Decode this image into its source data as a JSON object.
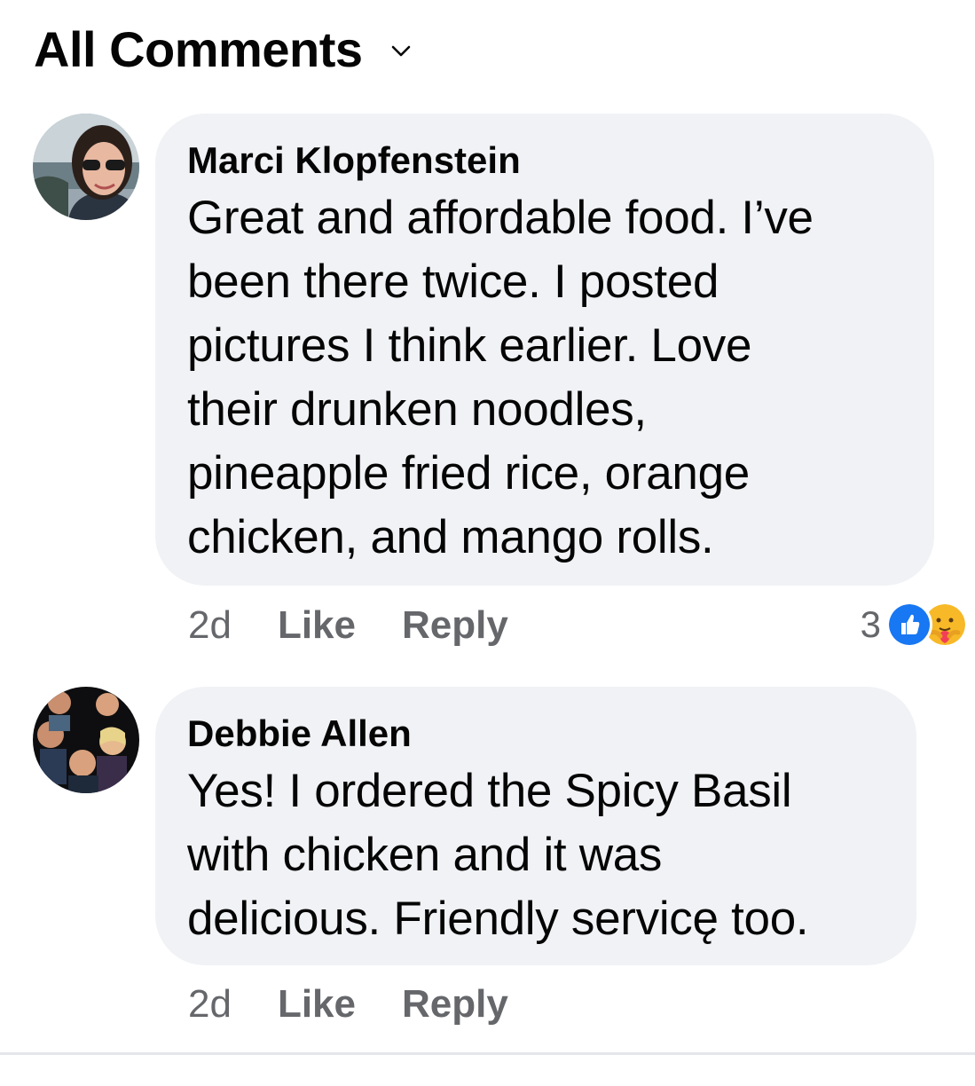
{
  "header": {
    "title": "All Comments",
    "chevron_icon": "chevron-down-icon"
  },
  "comments": [
    {
      "author": "Marci Klopfenstein",
      "lines": [
        "Great and affordable food.  I’ve",
        "been there twice.  I posted",
        "pictures I think earlier.  Love",
        "their drunken noodles,",
        "pineapple fried rice, orange",
        "chicken, and mango rolls."
      ],
      "time": "2d",
      "like_label": "Like",
      "reply_label": "Reply",
      "reaction_count": "3",
      "reactions": [
        "like-reaction-icon",
        "care-reaction-icon"
      ]
    },
    {
      "author": "Debbie Allen",
      "lines": [
        "Yes! I ordered the Spicy Basil",
        "with chicken and it was",
        "delicious. Friendly servicę too."
      ],
      "time": "2d",
      "like_label": "Like",
      "reply_label": "Reply"
    }
  ],
  "colors": {
    "bubble": "#f0f2f5",
    "meta_text": "#65676b",
    "like_blue": "#1877f2",
    "care_yellow": "#f7b928"
  }
}
